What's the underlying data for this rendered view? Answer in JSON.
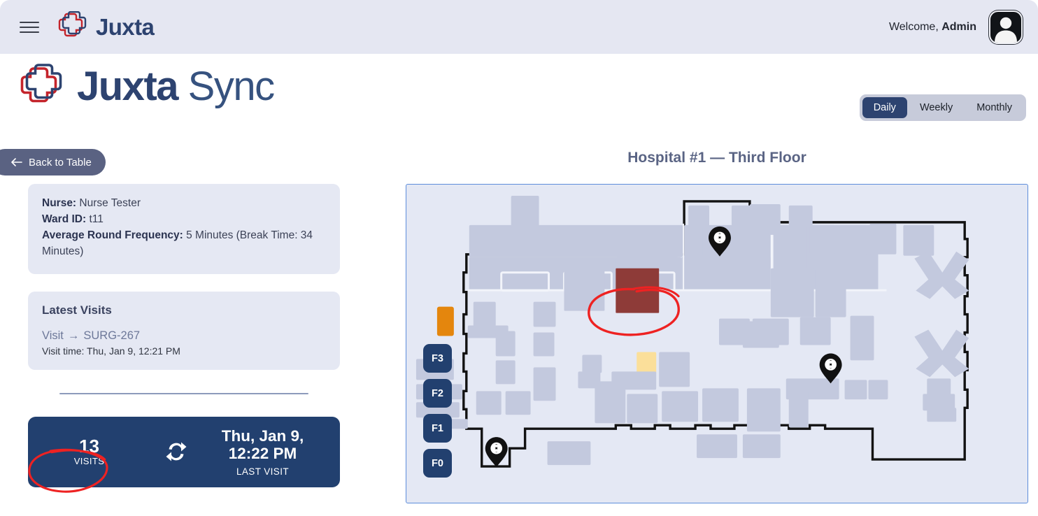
{
  "appbar": {
    "menu_icon": "hamburger-icon",
    "logo_icon": "juxta-cross-logo",
    "brand": "Juxta",
    "welcome_prefix": "Welcome, ",
    "welcome_user": "Admin",
    "avatar_icon": "user-avatar-icon"
  },
  "hero": {
    "logo_icon": "juxta-cross-logo",
    "brand_bold": "Juxta",
    "brand_light": " Sync"
  },
  "period_toggle": {
    "options": [
      {
        "label": "Daily",
        "active": true
      },
      {
        "label": "Weekly",
        "active": false
      },
      {
        "label": "Monthly",
        "active": false
      }
    ]
  },
  "back_button": {
    "icon": "arrow-left-icon",
    "label": "Back to Table"
  },
  "info": {
    "nurse_label": "Nurse:",
    "nurse_value": " Nurse Tester",
    "ward_label": "Ward ID:",
    "ward_value": " t11",
    "freq_label": "Average Round Frequency:",
    "freq_value": " 5 Minutes (Break Time: 34 Minutes)"
  },
  "latest_visits": {
    "heading": "Latest Visits",
    "visit_word": "Visit",
    "arrow": "→",
    "visit_id": "SURG-267",
    "visit_time": "Visit time: Thu, Jan 9, 12:21 PM"
  },
  "stats": {
    "count": "13",
    "count_label": "VISITS",
    "sync_icon": "refresh-sync-icon",
    "datetime_line1": "Thu, Jan 9,",
    "datetime_line2": "12:22 PM",
    "datetime_sub": "LAST VISIT",
    "annotation": "red-ellipse-annotation"
  },
  "map": {
    "title": "Hospital #1 — Third Floor",
    "floors": [
      "F3",
      "F2",
      "F1",
      "F0"
    ],
    "active_floor": "F3",
    "highlight_room_color": "#8e3b38",
    "orange_room_color": "#e4860d",
    "yellow_room_color": "#fbdf9a",
    "room_color": "#c3c9de",
    "background_color": "#e4e8f4",
    "wall_color": "#121212",
    "annotation": "red-ellipse-annotation",
    "pins": [
      "location-pin-icon",
      "location-pin-icon",
      "location-pin-icon"
    ],
    "stair_markers": [
      "stair-x-icon",
      "stair-x-icon"
    ]
  },
  "colors": {
    "navy": "#22406f",
    "brand_navy": "#2d4370",
    "accent_red": "#ee2222",
    "header_bg": "#e5e7f2",
    "card_bg": "#e5e8f3"
  }
}
